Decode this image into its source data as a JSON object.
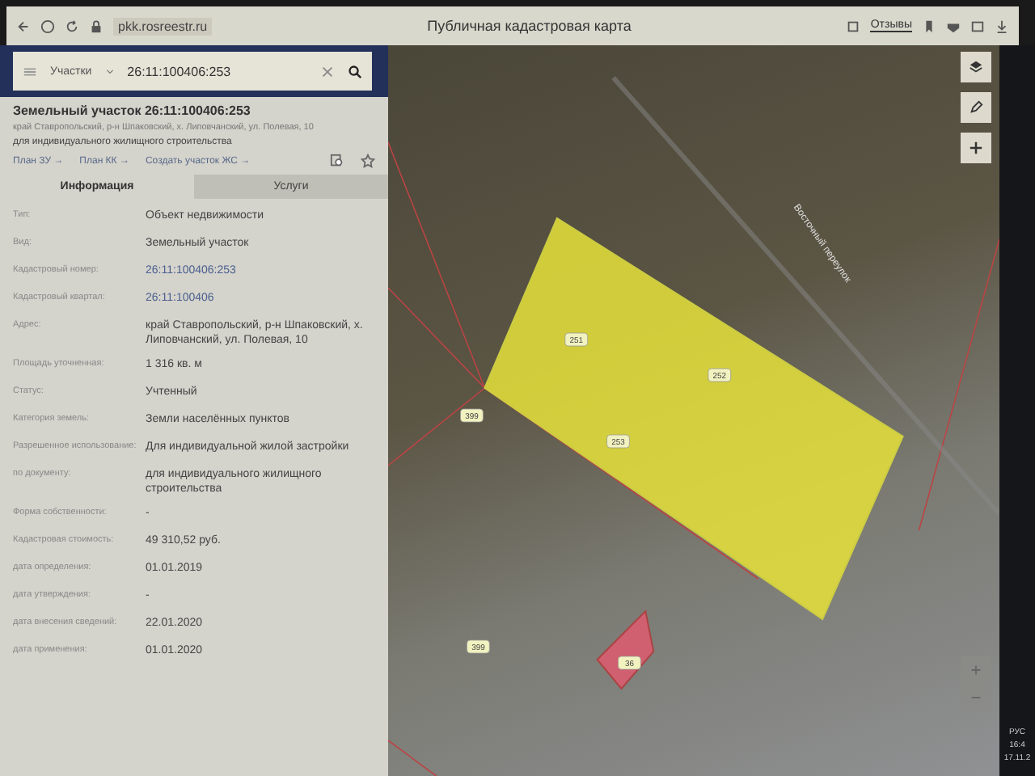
{
  "browser": {
    "url": "pkk.rosreestr.ru",
    "title": "Публичная кадастровая карта",
    "feedback_label": "Отзывы"
  },
  "search": {
    "category": "Участки",
    "value": "26:11:100406:253"
  },
  "object": {
    "title": "Земельный участок 26:11:100406:253",
    "address": "край Ставропольский, р-н Шпаковский, х. Липовчанский, ул. Полевая, 10",
    "purpose": "для индивидуального жилищного строительства",
    "links": [
      "План ЗУ →",
      "План КК →",
      "Создать участок ЖС →"
    ]
  },
  "tabs": [
    {
      "label": "Информация",
      "selected": true
    },
    {
      "label": "Услуги",
      "selected": false
    }
  ],
  "properties": [
    {
      "label": "Тип:",
      "value": "Объект недвижимости",
      "kind": "text"
    },
    {
      "label": "Вид:",
      "value": "Земельный участок",
      "kind": "text"
    },
    {
      "label": "Кадастровый номер:",
      "value": "26:11:100406:253",
      "kind": "link"
    },
    {
      "label": "Кадастровый квартал:",
      "value": "26:11:100406",
      "kind": "link"
    },
    {
      "label": "Адрес:",
      "value": "край Ставропольский, р-н Шпаковский, х. Липовчанский, ул. Полевая, 10",
      "kind": "text"
    },
    {
      "label": "Площадь уточненная:",
      "value": "1 316 кв. м",
      "kind": "text"
    },
    {
      "label": "Статус:",
      "value": "Учтенный",
      "kind": "text"
    },
    {
      "label": "Категория земель:",
      "value": "Земли населённых пунктов",
      "kind": "text"
    },
    {
      "label": "Разрешенное использование:",
      "value": "Для индивидуальной жилой застройки",
      "kind": "text"
    },
    {
      "label": "по документу:",
      "value": "для индивидуального жилищного строительства",
      "kind": "text"
    },
    {
      "label": "Форма собственности:",
      "value": "-",
      "kind": "text"
    },
    {
      "label": "Кадастровая стоимость:",
      "value": "49 310,52 руб.",
      "kind": "text"
    },
    {
      "label": "дата определения:",
      "value": "01.01.2019",
      "kind": "text"
    },
    {
      "label": "дата утверждения:",
      "value": "-",
      "kind": "text"
    },
    {
      "label": "дата внесения сведений:",
      "value": "22.01.2020",
      "kind": "text"
    },
    {
      "label": "дата применения:",
      "value": "01.01.2020",
      "kind": "text"
    }
  ],
  "map": {
    "street_label": "Восточный переулок",
    "labels": [
      "251",
      "252",
      "253",
      "399",
      "399",
      "36"
    ]
  },
  "taskbar": {
    "language": "РУС",
    "time": "16:4",
    "date": "17.11.2"
  }
}
